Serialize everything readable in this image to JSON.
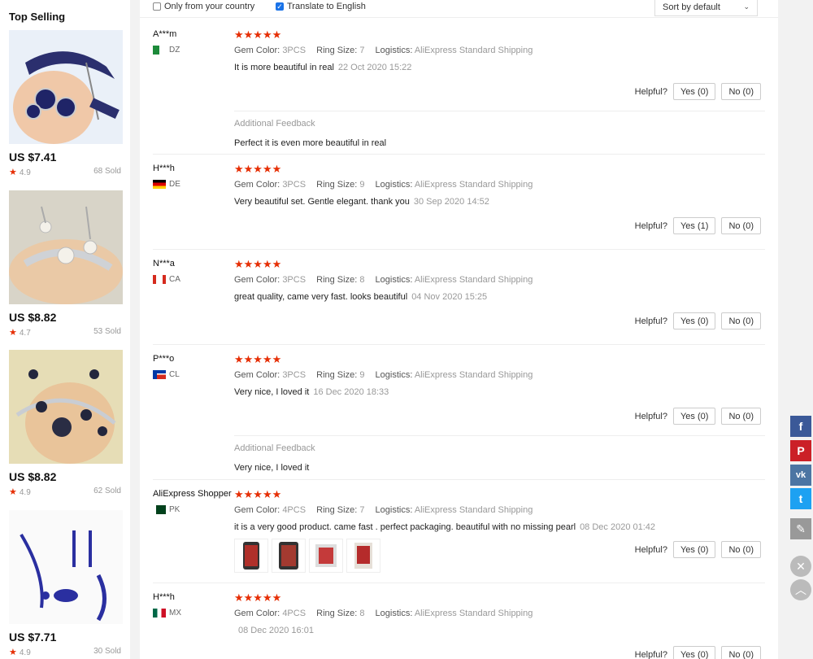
{
  "sidebar": {
    "title": "Top Selling",
    "products": [
      {
        "price": "US $7.41",
        "rating": "4.9",
        "sold": "68 Sold",
        "image": "blue-jewelry-set"
      },
      {
        "price": "US $8.82",
        "rating": "4.7",
        "sold": "53 Sold",
        "image": "pearl-jewelry-set"
      },
      {
        "price": "US $8.82",
        "rating": "4.9",
        "sold": "62 Sold",
        "image": "black-pearl-jewelry-set"
      },
      {
        "price": "US $7.71",
        "rating": "4.9",
        "sold": "30 Sold",
        "image": "blue-crystal-jewelry-set"
      }
    ]
  },
  "filters": {
    "only_country": "Only from your country",
    "translate": "Translate to English",
    "sort": "Sort by default"
  },
  "labels": {
    "gem_color": "Gem Color:",
    "ring_size": "Ring Size:",
    "logistics": "Logistics:",
    "helpful": "Helpful?",
    "additional": "Additional Feedback",
    "stars": "★★★★★"
  },
  "reviews": [
    {
      "user": "A***m",
      "country": "DZ",
      "gem": "3PCS",
      "ring": "7",
      "logistics": "AliExpress Standard Shipping",
      "text": "It is more beautiful in real",
      "date": "22 Oct 2020 15:22",
      "yes": "Yes (0)",
      "no": "No (0)",
      "additional": "Perfect it is even more beautiful in real"
    },
    {
      "user": "H***h",
      "country": "DE",
      "gem": "3PCS",
      "ring": "9",
      "logistics": "AliExpress Standard Shipping",
      "text": "Very beautiful set. Gentle elegant. thank you",
      "date": "30 Sep 2020 14:52",
      "yes": "Yes (1)",
      "no": "No (0)"
    },
    {
      "user": "N***a",
      "country": "CA",
      "gem": "3PCS",
      "ring": "8",
      "logistics": "AliExpress Standard Shipping",
      "text": "great quality, came very fast. looks beautiful",
      "date": "04 Nov 2020 15:25",
      "yes": "Yes (0)",
      "no": "No (0)"
    },
    {
      "user": "P***o",
      "country": "CL",
      "gem": "3PCS",
      "ring": "9",
      "logistics": "AliExpress Standard Shipping",
      "text": "Very nice, I loved it",
      "date": "16 Dec 2020 18:33",
      "yes": "Yes (0)",
      "no": "No (0)",
      "additional": "Very nice, I loved it"
    },
    {
      "user": "AliExpress Shopper",
      "country": "PK",
      "gem": "4PCS",
      "ring": "7",
      "logistics": "AliExpress Standard Shipping",
      "text": "it is a very good product. came fast . perfect packaging. beautiful with no missing pearl",
      "date": "08 Dec 2020 01:42",
      "yes": "Yes (0)",
      "no": "No (0)"
    },
    {
      "user": "H***h",
      "country": "MX",
      "gem": "4PCS",
      "ring": "8",
      "logistics": "AliExpress Standard Shipping",
      "text": "",
      "date": "08 Dec 2020 16:01",
      "yes": "Yes (0)",
      "no": "No (0)"
    }
  ],
  "share": {
    "facebook": "f",
    "pinterest": "P",
    "vk": "vk",
    "twitter": "t",
    "edit": "✎",
    "close": "✕",
    "top": "︿"
  },
  "colors": {
    "star": "#e62e04",
    "facebook": "#3b5998",
    "pinterest": "#cb2027",
    "vk": "#4c75a3",
    "twitter": "#1da1f2"
  }
}
